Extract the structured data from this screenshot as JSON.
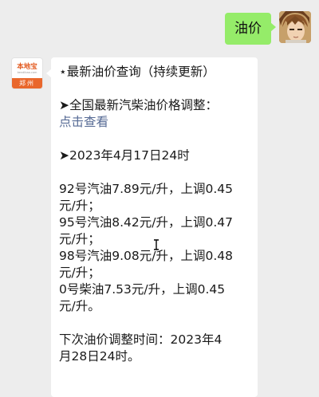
{
  "chat": {
    "outgoing": {
      "text": "油价"
    },
    "incoming": {
      "sender": {
        "logo_text": "本地宝",
        "logo_site": "bendibao.com",
        "logo_city": "郑州"
      },
      "title": "⋆最新油价查询（持续更新）",
      "section_label": "➤全国最新汽柴油价格调整：",
      "link_text": "点击查看",
      "date_line": "➤2023年4月17日24时",
      "prices": [
        {
          "l1": "92号汽油7.89元/升，上调0.45",
          "l2": "元/升；"
        },
        {
          "l1": "95号汽油8.42元/升，上调0.47",
          "l2": "元/升；"
        },
        {
          "l1": "98号汽油9.08元/升，上调0.48",
          "l2": "元/升；"
        },
        {
          "l1": "0号柴油7.53元/升，上调0.45",
          "l2": "元/升。"
        }
      ],
      "next_adjust_l1": "下次油价调整时间：2023年4",
      "next_adjust_l2": "月28日24时。"
    }
  },
  "colors": {
    "outgoing_bubble": "#95ec69",
    "link": "#576b95",
    "logo_accent": "#e9672c"
  },
  "icons": {
    "user_avatar": "anime-character-avatar",
    "sender_avatar": "bendibao-logo",
    "cursor": "text-cursor-icon"
  }
}
